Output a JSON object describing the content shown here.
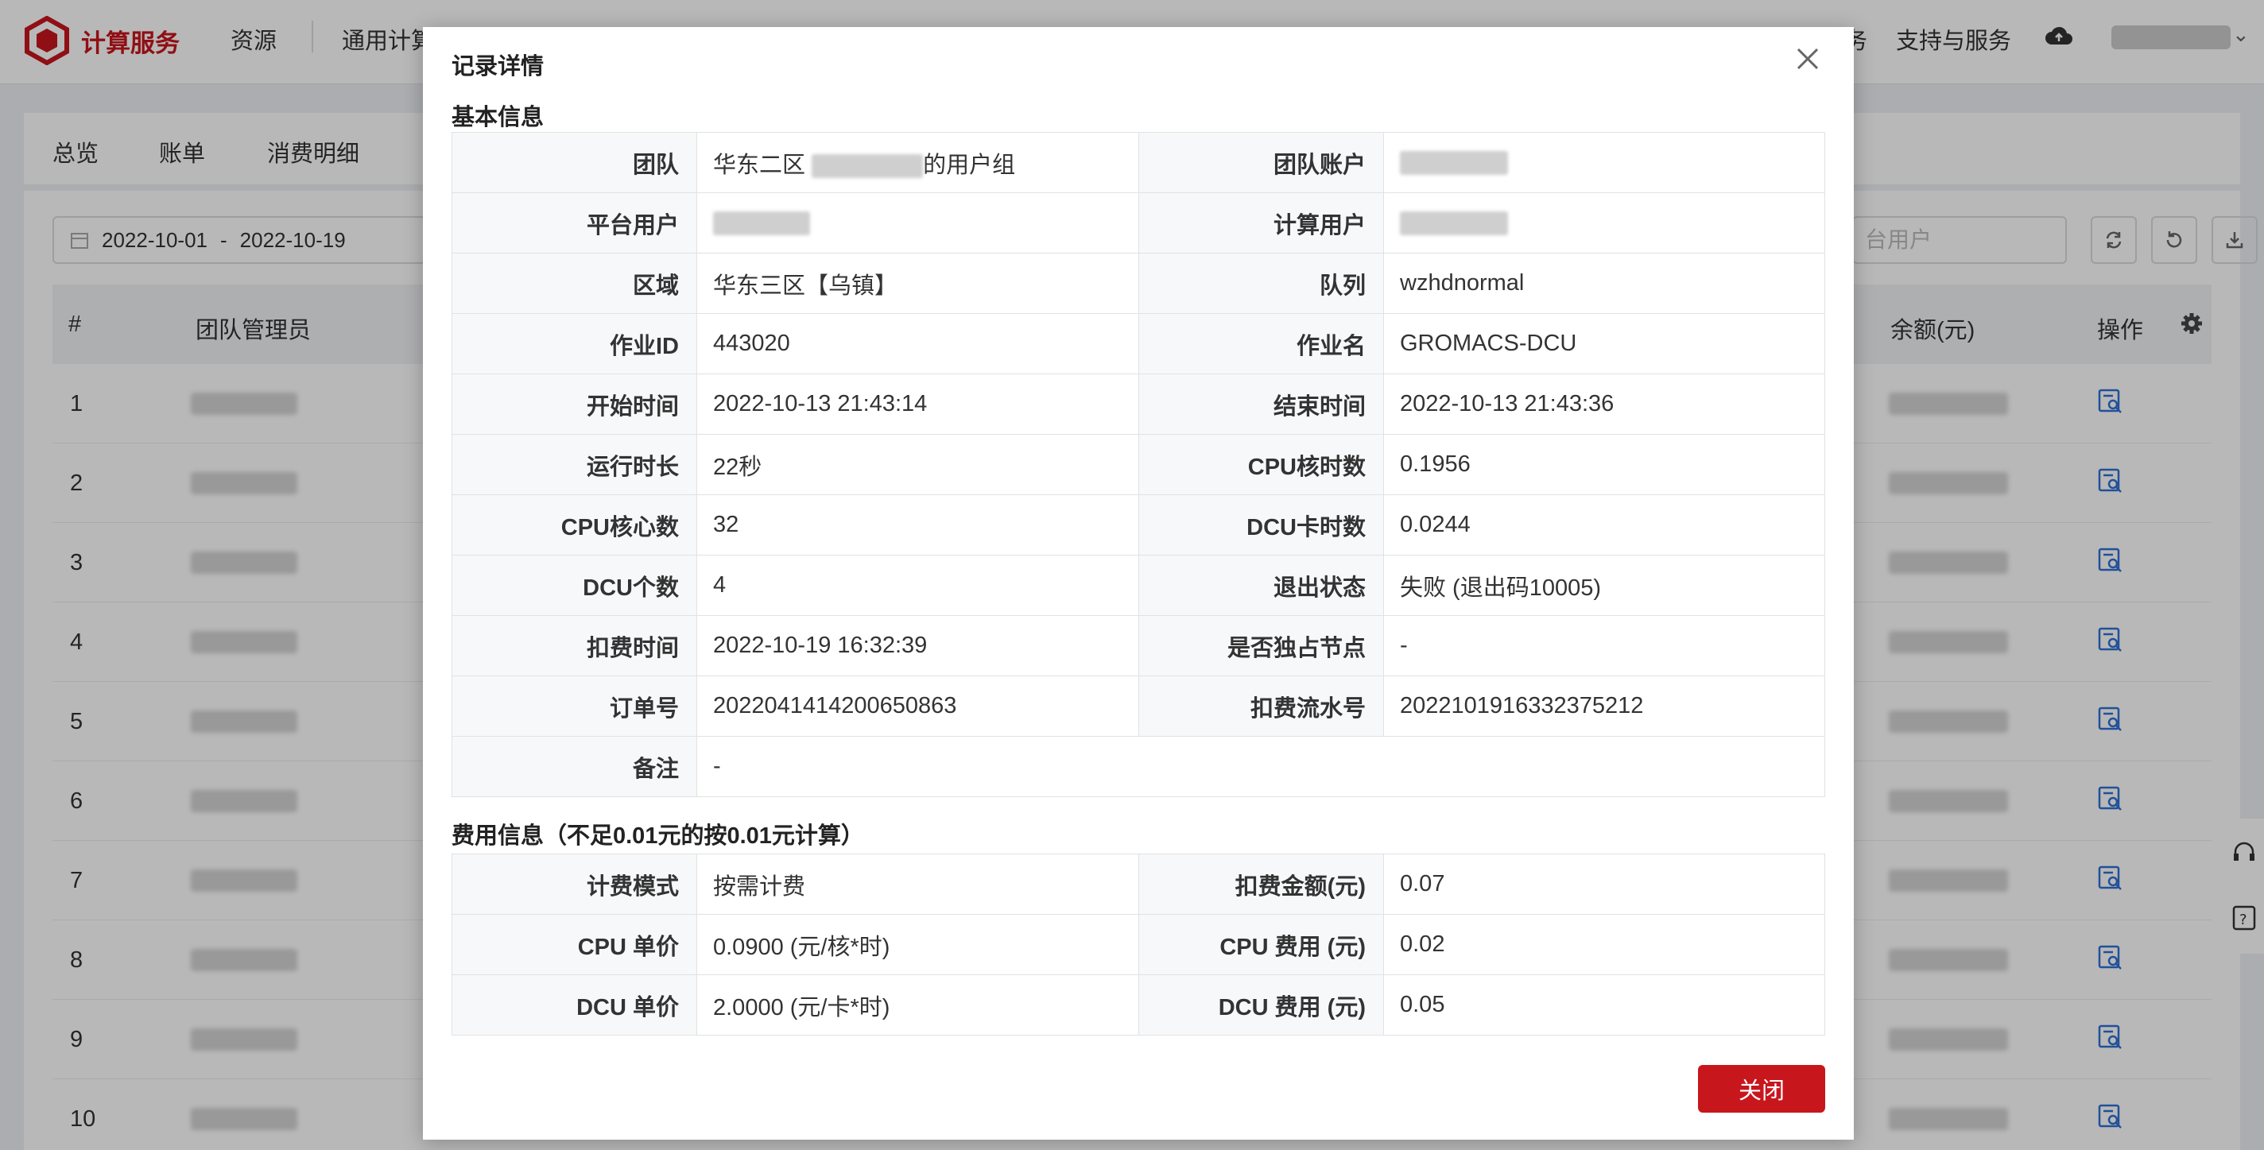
{
  "app": {
    "brand": "计算服务",
    "brand_color": "#c8161d"
  },
  "nav": {
    "items": [
      "资源",
      "通用计算"
    ],
    "right_items": [
      "务",
      "支持与服务"
    ]
  },
  "tabs": [
    "总览",
    "账单",
    "消费明细"
  ],
  "filters": {
    "date_start": "2022-10-01",
    "date_sep": "-",
    "date_end": "2022-10-19",
    "search_placeholder": "台用户"
  },
  "table": {
    "headers": {
      "num": "#",
      "admin": "团队管理员",
      "balance": "余额(元)",
      "ops": "操作"
    },
    "rows": [
      "1",
      "2",
      "3",
      "4",
      "5",
      "6",
      "7",
      "8",
      "9",
      "10"
    ]
  },
  "dialog": {
    "title": "记录详情",
    "basic_section": "基本信息",
    "basic": {
      "team_label": "团队",
      "team_prefix": "华东二区",
      "team_suffix": "的用户组",
      "team_account_label": "团队账户",
      "platform_user_label": "平台用户",
      "compute_user_label": "计算用户",
      "region_label": "区域",
      "region": "华东三区【乌镇】",
      "queue_label": "队列",
      "queue": "wzhdnormal",
      "job_id_label": "作业ID",
      "job_id": "443020",
      "job_name_label": "作业名",
      "job_name": "GROMACS-DCU",
      "start_label": "开始时间",
      "start": "2022-10-13 21:43:14",
      "end_label": "结束时间",
      "end": "2022-10-13 21:43:36",
      "duration_label": "运行时长",
      "duration": "22秒",
      "cpu_hours_label": "CPU核时数",
      "cpu_hours": "0.1956",
      "cpu_cores_label": "CPU核心数",
      "cpu_cores": "32",
      "dcu_hours_label": "DCU卡时数",
      "dcu_hours": "0.0244",
      "dcu_count_label": "DCU个数",
      "dcu_count": "4",
      "exit_label": "退出状态",
      "exit": "失败 (退出码10005)",
      "charge_time_label": "扣费时间",
      "charge_time": "2022-10-19 16:32:39",
      "exclusive_label": "是否独占节点",
      "exclusive": "-",
      "order_label": "订单号",
      "order": "2022041414200650863",
      "serial_label": "扣费流水号",
      "serial": "2022101916332375212",
      "remark_label": "备注",
      "remark": "-"
    },
    "fee_section": "费用信息（不足0.01元的按0.01元计算）",
    "fee": {
      "mode_label": "计费模式",
      "mode": "按需计费",
      "amount_label": "扣费金额(元)",
      "amount": "0.07",
      "cpu_price_label": "CPU 单价",
      "cpu_price": "0.0900 (元/核*时)",
      "cpu_fee_label": "CPU 费用 (元)",
      "cpu_fee": "0.02",
      "dcu_price_label": "DCU 单价",
      "dcu_price": "2.0000 (元/卡*时)",
      "dcu_fee_label": "DCU 费用 (元)",
      "dcu_fee": "0.05"
    },
    "close_button": "关闭"
  }
}
